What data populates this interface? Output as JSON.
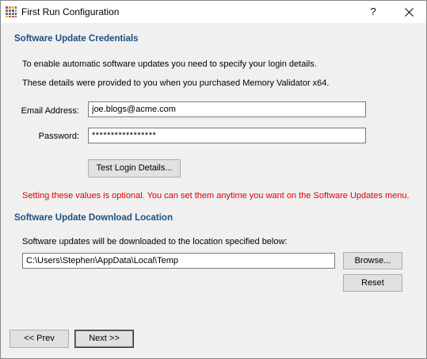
{
  "window": {
    "title": "First Run Configuration",
    "help_label": "?",
    "close_label": "✕"
  },
  "credentials": {
    "heading": "Software Update Credentials",
    "intro_line1": "To enable automatic software updates you need to specify your login details.",
    "intro_line2": "These details were provided to you when you purchased Memory Validator x64.",
    "email_label": "Email Address:",
    "email_value": "joe.blogs@acme.com",
    "password_label": "Password:",
    "password_value": "*****************",
    "test_button": "Test Login Details...",
    "optional_note": "Setting these values is optional. You can set them anytime you want on the Software Updates menu."
  },
  "download": {
    "heading": "Software Update Download Location",
    "description": "Software updates will be downloaded to the location specified below:",
    "path_value": "C:\\Users\\Stephen\\AppData\\Local\\Temp",
    "browse_button": "Browse...",
    "reset_button": "Reset"
  },
  "nav": {
    "prev_button": "<< Prev",
    "next_button": "Next >>"
  },
  "colors": {
    "heading": "#1f4f7f",
    "warning": "#e00000"
  }
}
